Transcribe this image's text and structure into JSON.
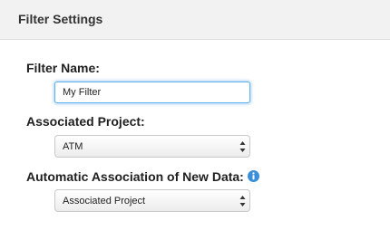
{
  "header": {
    "title": "Filter Settings"
  },
  "form": {
    "filter_name": {
      "label": "Filter Name:",
      "value": "My Filter"
    },
    "associated_project": {
      "label": "Associated Project:",
      "selected": "ATM"
    },
    "automatic_association": {
      "label": "Automatic Association of New Data:",
      "selected": "Associated Project",
      "info_icon": "info-icon"
    }
  },
  "colors": {
    "focus_border": "#66afe9",
    "info_blue": "#3b8fd8",
    "header_bg": "#f2f2f2"
  }
}
